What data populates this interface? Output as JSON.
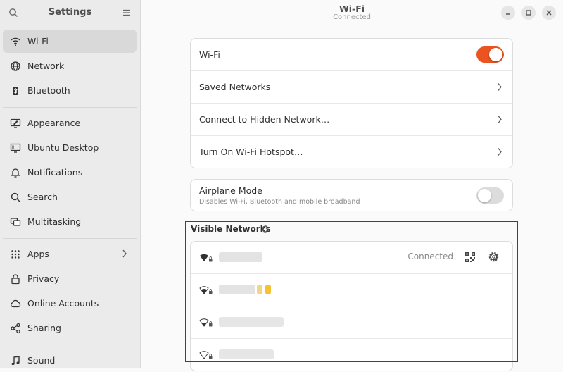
{
  "sidebar": {
    "title": "Settings",
    "items": [
      {
        "label": "Wi-Fi"
      },
      {
        "label": "Network"
      },
      {
        "label": "Bluetooth"
      },
      {
        "label": "Appearance"
      },
      {
        "label": "Ubuntu Desktop"
      },
      {
        "label": "Notifications"
      },
      {
        "label": "Search"
      },
      {
        "label": "Multitasking"
      },
      {
        "label": "Apps"
      },
      {
        "label": "Privacy"
      },
      {
        "label": "Online Accounts"
      },
      {
        "label": "Sharing"
      },
      {
        "label": "Sound"
      }
    ],
    "selected": "Wi-Fi"
  },
  "header": {
    "title": "Wi-Fi",
    "subtitle": "Connected"
  },
  "wifi_card": {
    "wifi_label": "Wi-Fi",
    "wifi_enabled": true,
    "saved_networks_label": "Saved Networks",
    "hidden_network_label": "Connect to Hidden Network…",
    "hotspot_label": "Turn On Wi-Fi Hotspot…"
  },
  "airplane": {
    "title": "Airplane Mode",
    "subtitle": "Disables Wi-Fi, Bluetooth and mobile broadband",
    "enabled": false
  },
  "visible_networks": {
    "title": "Visible Networks",
    "connected_label": "Connected",
    "networks": [
      {
        "name": "",
        "status": "connected",
        "secured": true
      },
      {
        "name": "",
        "status": "",
        "secured": true
      },
      {
        "name": "",
        "status": "",
        "secured": true
      },
      {
        "name": "",
        "status": "",
        "secured": true
      }
    ]
  },
  "colors": {
    "accent": "#e95420",
    "highlight": "#e00000"
  }
}
